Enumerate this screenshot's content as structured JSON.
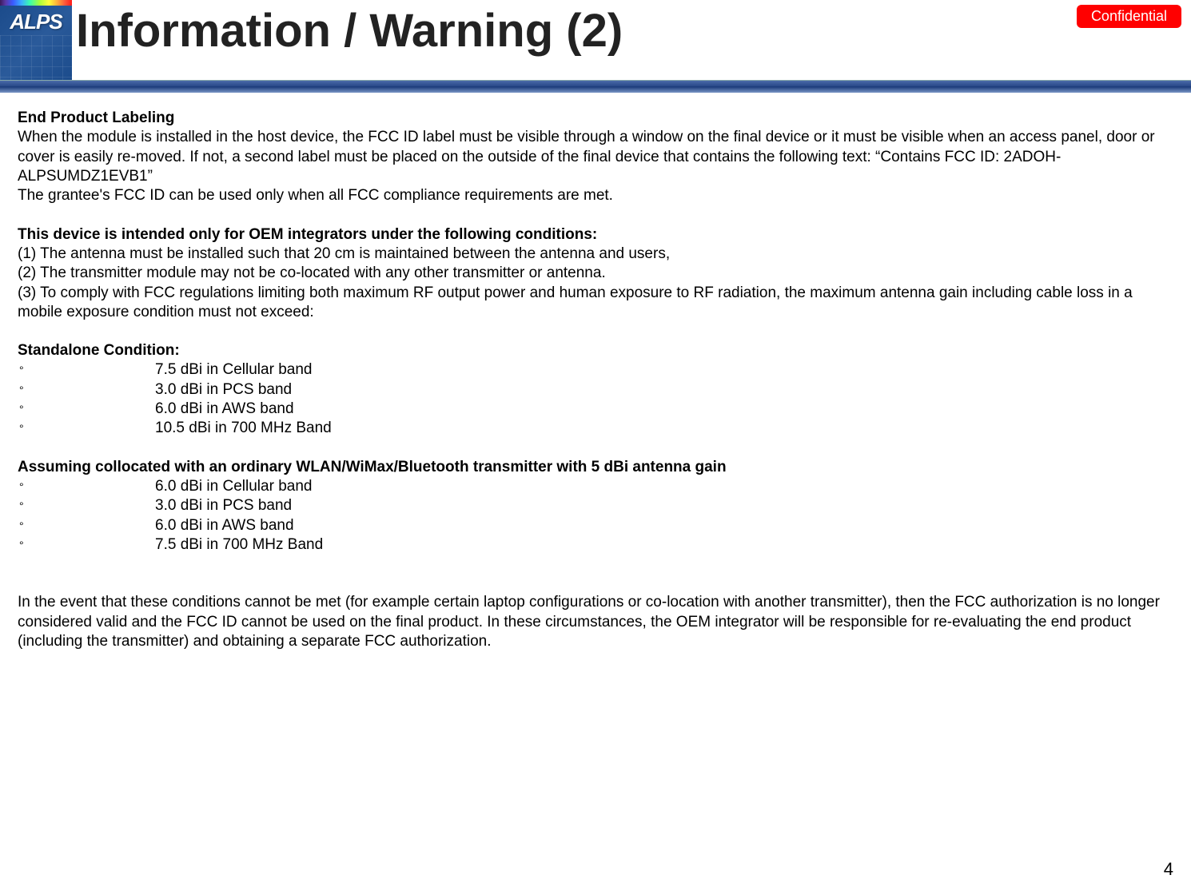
{
  "header": {
    "logo": "ALPS",
    "title": "Information / Warning (2)",
    "badge": "Confidential"
  },
  "sections": {
    "s1_heading": "End Product Labeling",
    "s1_p1": "When the module is installed in the host device, the FCC ID label must be visible through a window on the final device or it must be visible when an access panel, door or cover is easily re-moved. If not, a second label must be placed on the outside of the final device that contains the following text: “Contains FCC ID: 2ADOH-ALPSUMDZ1EVB1”",
    "s1_p2": "The grantee's FCC ID can be used only when all FCC compliance requirements are met.",
    "s2_heading": "This device is intended only for OEM integrators under the following conditions:",
    "s2_i1": "(1) The antenna must be installed such that 20 cm is maintained between the antenna and users,",
    "s2_i2": "(2) The transmitter module may not be co-located with any other transmitter or antenna.",
    "s2_i3": "(3) To comply with FCC regulations limiting both maximum RF output power and human exposure to RF radiation, the maximum antenna gain including cable loss in a mobile exposure condition must not exceed:",
    "s3_heading": "Standalone Condition:",
    "s3": {
      "b1": "7.5 dBi in Cellular band",
      "b2": "3.0 dBi in PCS band",
      "b3": "6.0 dBi in AWS band",
      "b4": "10.5 dBi in 700 MHz Band"
    },
    "s4_heading": "Assuming collocated with an ordinary WLAN/WiMax/Bluetooth transmitter with 5 dBi antenna gain",
    "s4": {
      "b1": "6.0 dBi in Cellular band",
      "b2": "3.0 dBi in PCS band",
      "b3": "6.0 dBi in AWS band",
      "b4": "7.5 dBi in 700 MHz Band"
    },
    "closing": "In the event that these conditions cannot be met (for example certain laptop configurations or co-location with another transmitter), then the FCC authorization is no longer considered valid and the FCC ID cannot be used on the final product. In these circumstances, the OEM integrator will be responsible for re-evaluating the end product (including the transmitter) and obtaining a separate FCC authorization."
  },
  "pageNumber": "4"
}
